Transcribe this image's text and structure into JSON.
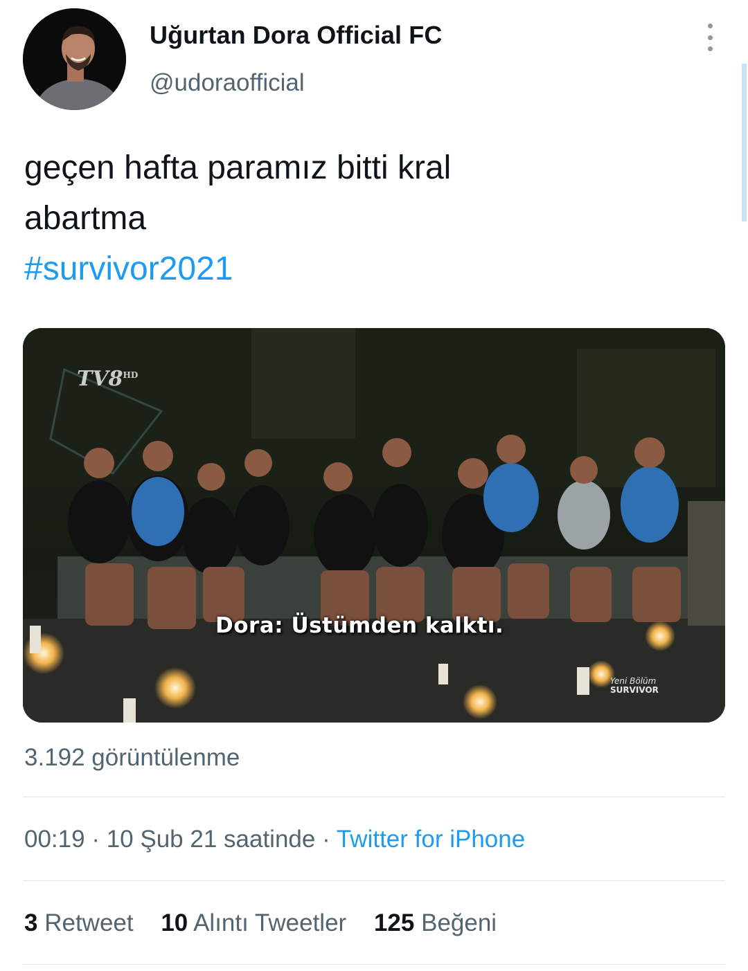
{
  "author": {
    "name": "Uğurtan Dora Official FC",
    "handle": "@udoraofficial"
  },
  "tweet": {
    "lines": [
      "geçen hafta paramız bitti kral",
      "abartma"
    ],
    "hashtag": "#survivor2021"
  },
  "media": {
    "logo": "TV8",
    "logo_hd": "HD",
    "caption_speaker": "Dora:",
    "caption_text": "Üstümden kalktı.",
    "watermark_line1": "Yeni Bölüm",
    "watermark_line2": "SURVIVOR"
  },
  "views": "3.192 görüntülenme",
  "meta": {
    "time": "00:19",
    "date": "10 Şub 21 saatinde",
    "separator": "·",
    "source": "Twitter for iPhone"
  },
  "stats": {
    "retweets_count": "3",
    "retweets_label": "Retweet",
    "quotes_count": "10",
    "quotes_label": "Alıntı Tweetler",
    "likes_count": "125",
    "likes_label": "Beğeni"
  },
  "colors": {
    "link": "#1d9bf0",
    "secondary_text": "#536471",
    "primary_text": "#0f1419"
  },
  "icons": [
    "more-options-icon"
  ]
}
